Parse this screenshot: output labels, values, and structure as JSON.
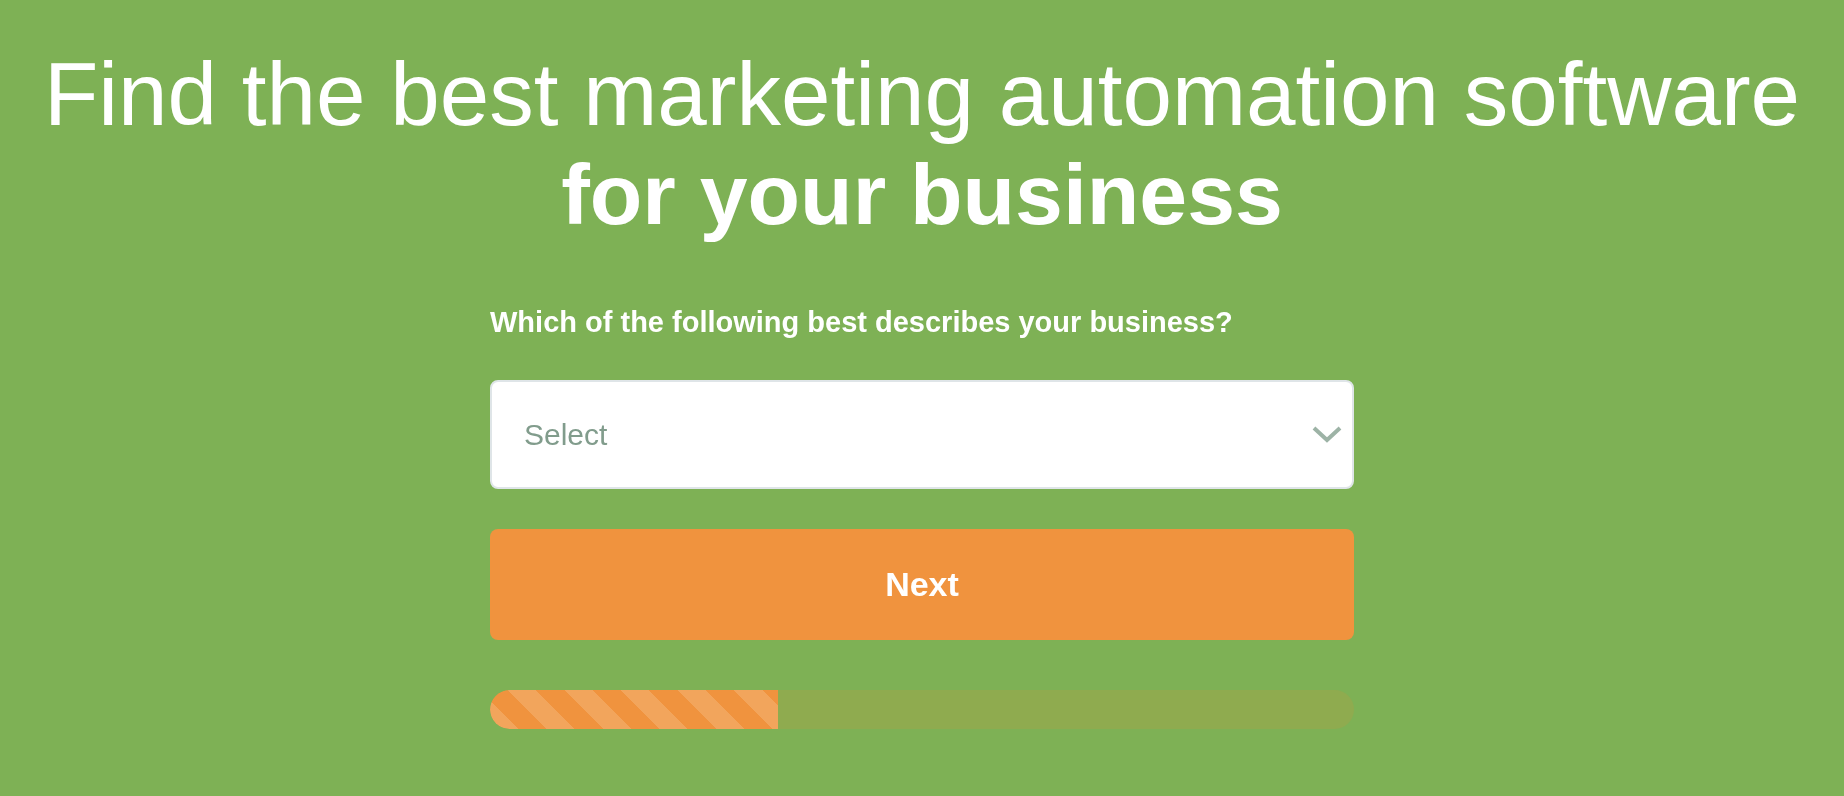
{
  "headline": {
    "line_1": "Find the best marketing automation software",
    "line_2": "for your business"
  },
  "question": {
    "label": "Which of the following best describes your business?",
    "select": {
      "placeholder": "Select"
    }
  },
  "next_button": {
    "label": "Next"
  },
  "progress": {
    "level": 0.333
  }
}
